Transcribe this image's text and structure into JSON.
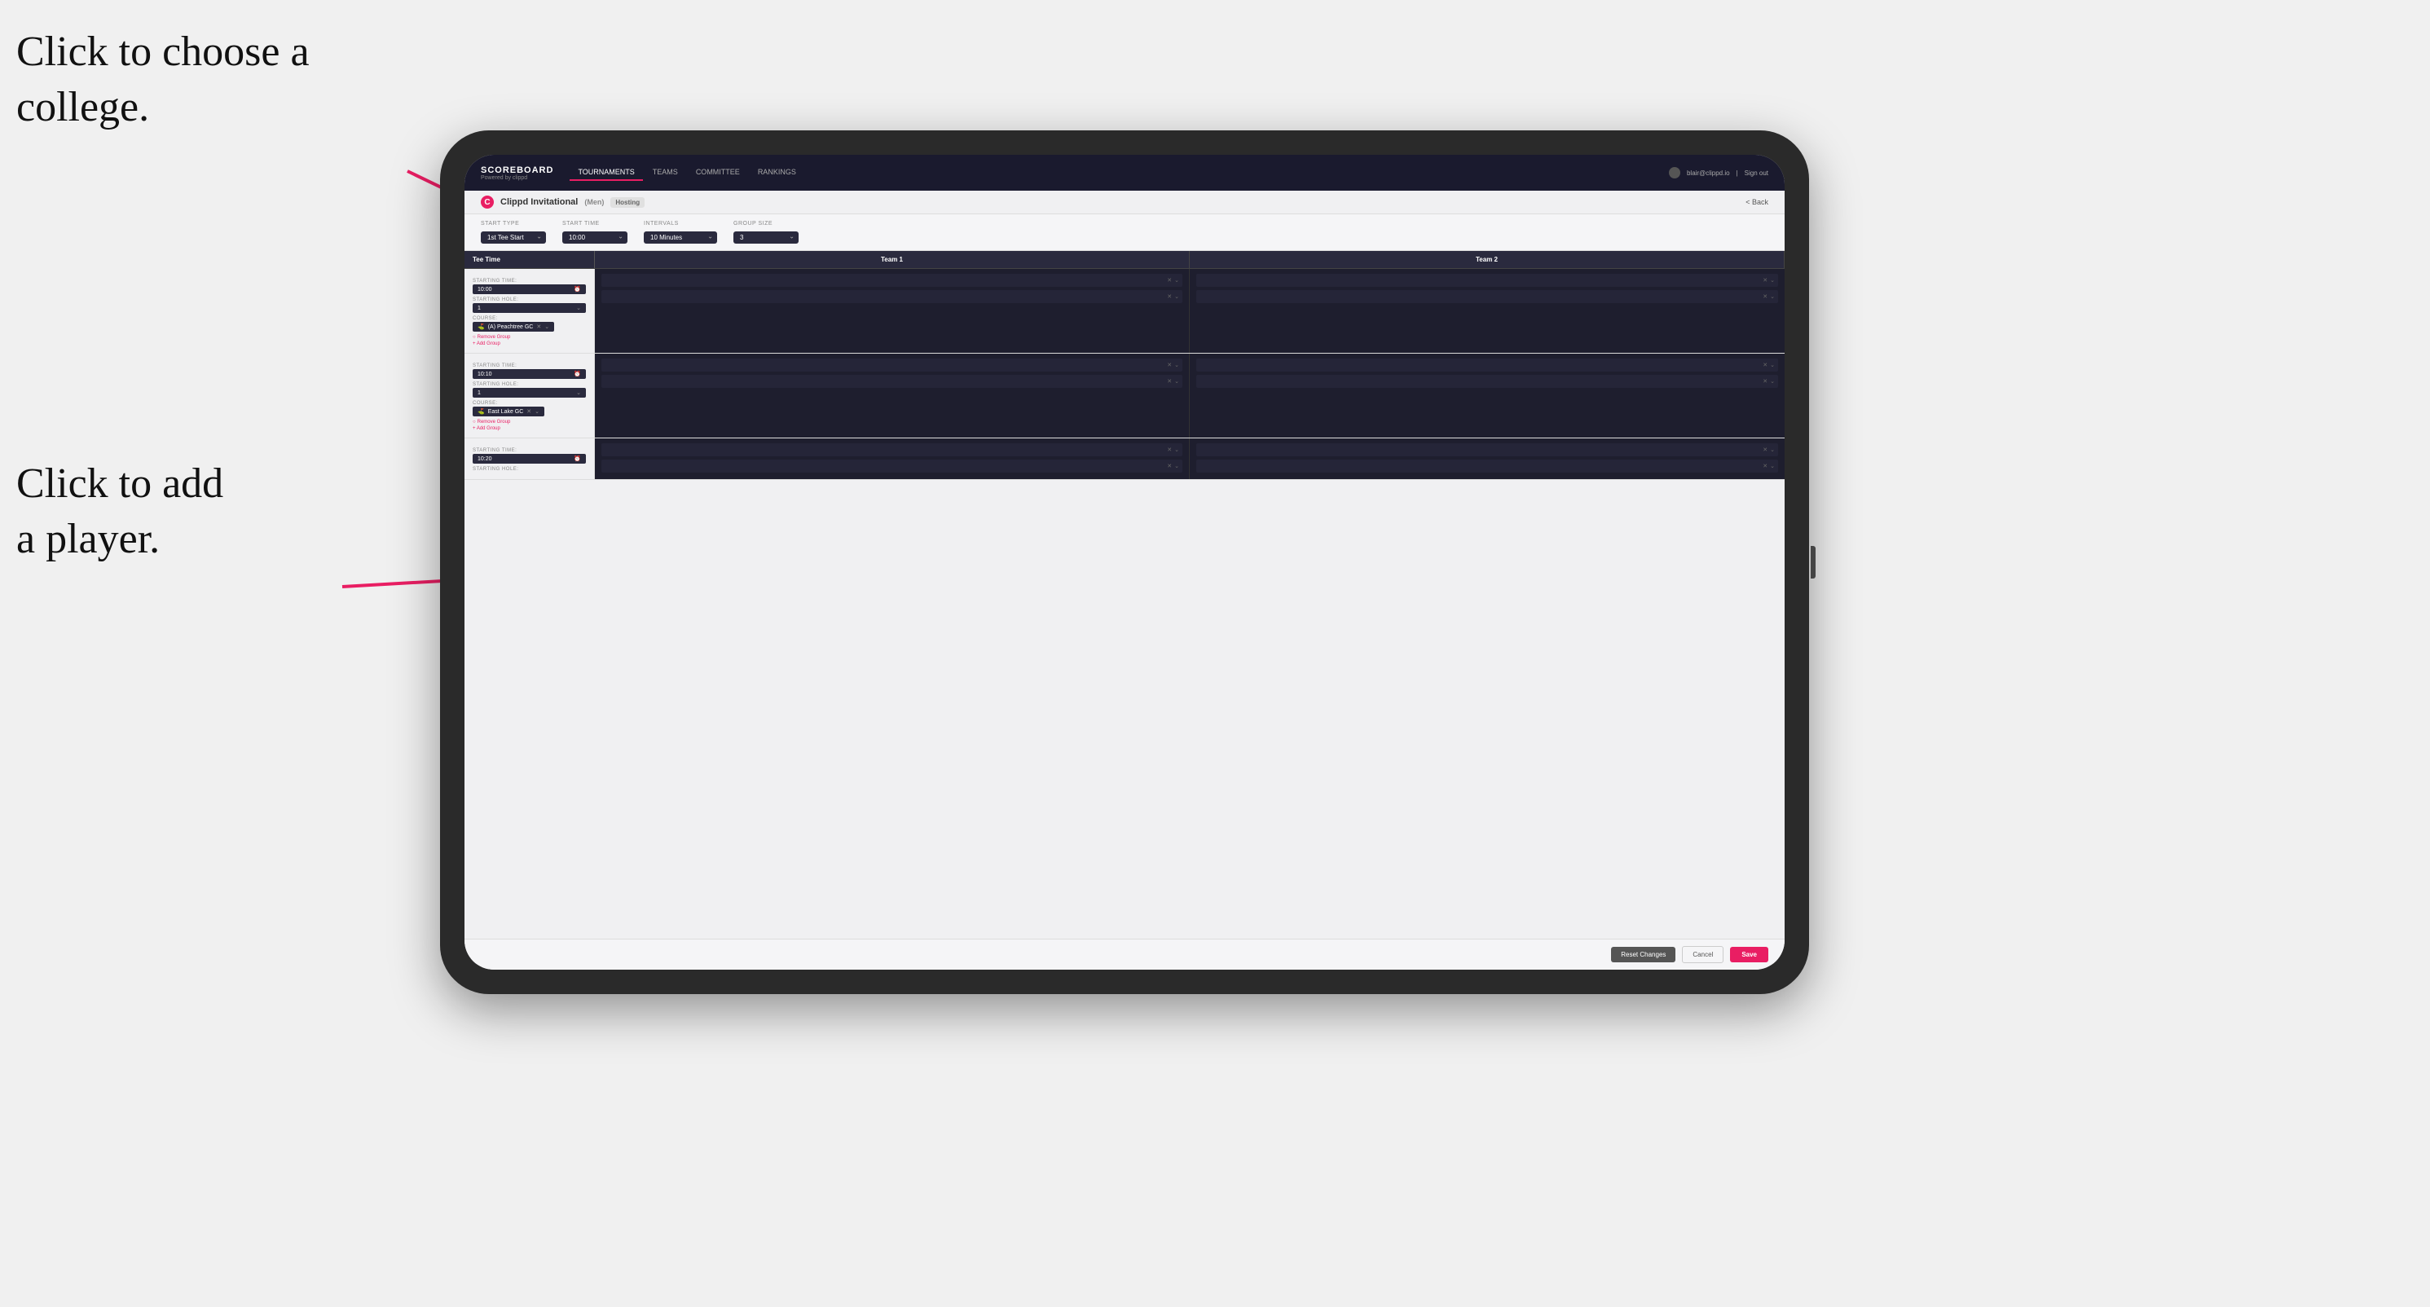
{
  "annotations": {
    "text1_line1": "Click to choose a",
    "text1_line2": "college.",
    "text2_line1": "Click to add",
    "text2_line2": "a player."
  },
  "header": {
    "logo": "SCOREBOARD",
    "powered_by": "Powered by clippd",
    "nav": [
      "TOURNAMENTS",
      "TEAMS",
      "COMMITTEE",
      "RANKINGS"
    ],
    "active_nav": "TOURNAMENTS",
    "user_email": "blair@clippd.io",
    "sign_out": "Sign out"
  },
  "sub_header": {
    "tournament": "Clippd Invitational",
    "gender": "(Men)",
    "hosting": "Hosting",
    "back": "Back"
  },
  "settings": {
    "start_type_label": "Start Type",
    "start_type_value": "1st Tee Start",
    "start_time_label": "Start Time",
    "start_time_value": "10:00",
    "intervals_label": "Intervals",
    "intervals_value": "10 Minutes",
    "group_size_label": "Group Size",
    "group_size_value": "3"
  },
  "table": {
    "col1": "Tee Time",
    "col2": "Team 1",
    "col3": "Team 2"
  },
  "groups": [
    {
      "starting_time": "10:00",
      "starting_hole": "1",
      "course": "(A) Peachtree GC",
      "players_team1": 2,
      "players_team2": 2
    },
    {
      "starting_time": "10:10",
      "starting_hole": "1",
      "course": "East Lake GC",
      "players_team1": 2,
      "players_team2": 2
    },
    {
      "starting_time": "10:20",
      "starting_hole": "",
      "course": "",
      "players_team1": 2,
      "players_team2": 2
    }
  ],
  "actions": {
    "remove_group": "Remove Group",
    "add_group": "+ Add Group"
  },
  "footer": {
    "reset": "Reset Changes",
    "cancel": "Cancel",
    "save": "Save"
  }
}
